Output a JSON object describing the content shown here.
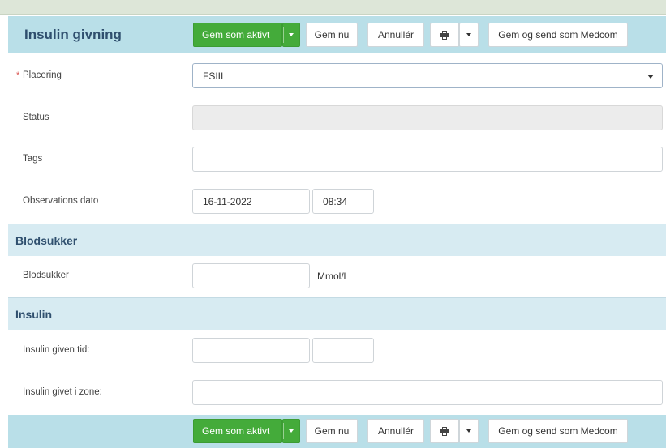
{
  "form": {
    "title": "Insulin givning"
  },
  "toolbar": {
    "save_active_label": "Gem som aktivt",
    "save_now_label": "Gem nu",
    "cancel_label": "Annullér",
    "print_icon": "printer-icon",
    "save_send_label": "Gem og send som Medcom"
  },
  "fields": {
    "placering": {
      "label": "Placering",
      "required_marker": "*",
      "value": "FSIII"
    },
    "status": {
      "label": "Status",
      "value": ""
    },
    "tags": {
      "label": "Tags",
      "value": ""
    },
    "obs_dato": {
      "label": "Observations dato",
      "date": "16-11-2022",
      "time": "08:34"
    }
  },
  "blodsukker_section": {
    "title": "Blodsukker",
    "field": {
      "label": "Blodsukker",
      "value": "",
      "unit": "Mmol/l"
    }
  },
  "insulin_section": {
    "title": "Insulin",
    "given_tid": {
      "label": "Insulin given tid:",
      "date": "",
      "time": ""
    },
    "zone": {
      "label": "Insulin givet i zone:",
      "value": ""
    }
  },
  "colors": {
    "accent_green": "#44ab3a",
    "header_blue": "#b9dfe8",
    "section_blue": "#d7ebf2",
    "title_color": "#2f4f6e"
  }
}
